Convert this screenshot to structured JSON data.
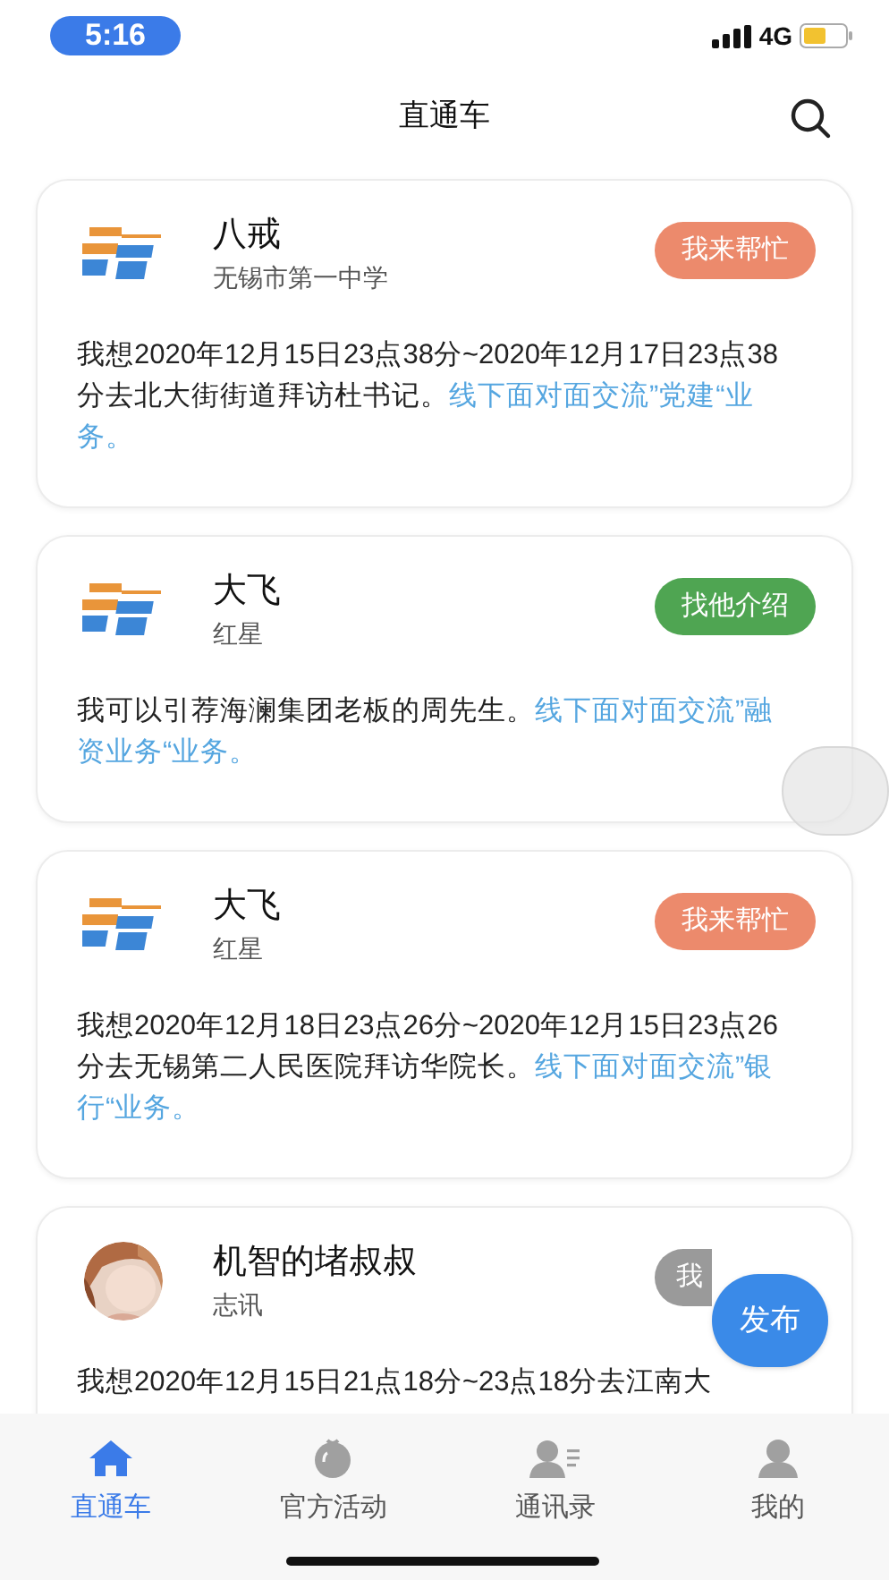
{
  "status_bar": {
    "time": "5:16",
    "network": "4G"
  },
  "header": {
    "title": "直通车"
  },
  "posts": [
    {
      "kind": "logo",
      "name": "八戒",
      "org": "无锡市第一中学",
      "button": {
        "label": "我来帮忙",
        "color": "#ec8a6c"
      },
      "text": "我想2020年12月15日23点38分~2020年12月17日23点38分去北大街街道拜访杜书记。",
      "link": "线下面对面交流”党建“业务。"
    },
    {
      "kind": "logo",
      "name": "大飞",
      "org": "红星",
      "button": {
        "label": "找他介绍",
        "color": "#4fa552"
      },
      "text": "我可以引荐海澜集团老板的周先生。",
      "link": "线下面对面交流”融资业务“业务。"
    },
    {
      "kind": "logo",
      "name": "大飞",
      "org": "红星",
      "button": {
        "label": "我来帮忙",
        "color": "#ec8a6c"
      },
      "text": "我想2020年12月18日23点26分~2020年12月15日23点26分去无锡第二人民医院拜访华院长。",
      "link": "线下面对面交流”银行“业务。"
    },
    {
      "name": "机智的堵叔叔",
      "org": "志讯",
      "button": {
        "label": "我",
        "color": "#9a9a9a"
      },
      "text": "我想2020年12月15日21点18分~23点18分去江南大"
    }
  ],
  "publish_button": {
    "label": "发布"
  },
  "tabs": [
    {
      "label": "直通车",
      "selected": true
    },
    {
      "label": "官方活动",
      "selected": false
    },
    {
      "label": "通讯录",
      "selected": false
    },
    {
      "label": "我的",
      "selected": false
    }
  ]
}
